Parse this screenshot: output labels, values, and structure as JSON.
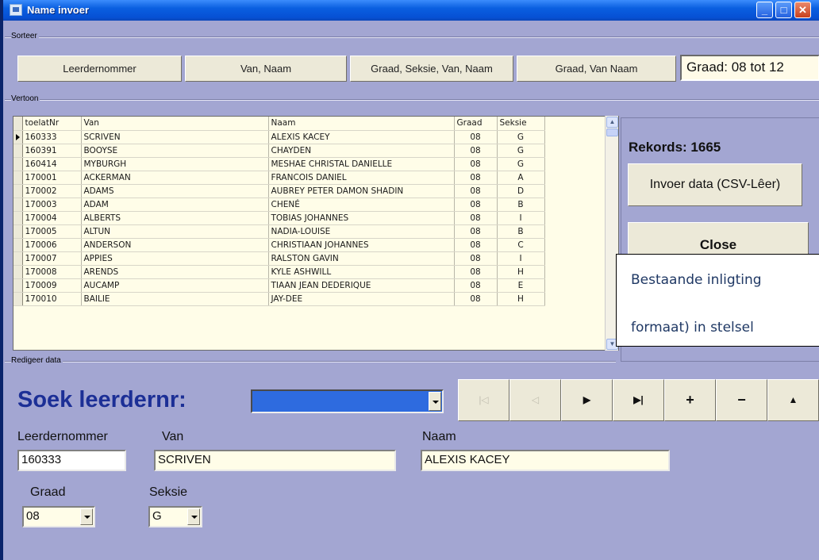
{
  "window": {
    "title": "Name invoer"
  },
  "sorteer": {
    "group_label": "Sorteer",
    "buttons": [
      "Leerdernommer",
      "Van, Naam",
      "Graad, Seksie, Van, Naam",
      "Graad, Van Naam"
    ],
    "graad_range": "Graad:  08 tot 12"
  },
  "vertoon": {
    "group_label": "Vertoon",
    "columns": [
      "toelatNr",
      "Van",
      "Naam",
      "Graad",
      "Seksie"
    ],
    "rows": [
      [
        "160333",
        "SCRIVEN",
        "ALEXIS KACEY",
        "08",
        "G"
      ],
      [
        "160391",
        "BOOYSE",
        "CHAYDEN",
        "08",
        "G"
      ],
      [
        "160414",
        "MYBURGH",
        "MESHAE CHRISTAL DANIELLE",
        "08",
        "G"
      ],
      [
        "170001",
        "ACKERMAN",
        "FRANCOIS DANIEL",
        "08",
        "A"
      ],
      [
        "170002",
        "ADAMS",
        "AUBREY PETER DAMON SHADIN",
        "08",
        "D"
      ],
      [
        "170003",
        "ADAM",
        "CHENÉ",
        "08",
        "B"
      ],
      [
        "170004",
        "ALBERTS",
        "TOBIAS JOHANNES",
        "08",
        "I"
      ],
      [
        "170005",
        "ALTUN",
        "NADIA-LOUISE",
        "08",
        "B"
      ],
      [
        "170006",
        "ANDERSON",
        "CHRISTIAAN JOHANNES",
        "08",
        "C"
      ],
      [
        "170007",
        "APPIES",
        "RALSTON GAVIN",
        "08",
        "I"
      ],
      [
        "170008",
        "ARENDS",
        "KYLE ASHWILL",
        "08",
        "H"
      ],
      [
        "170009",
        "AUCAMP",
        "TIAAN JEAN DEDERIQUE",
        "08",
        "E"
      ],
      [
        "170010",
        "BAILIE",
        "JAY-DEE",
        "08",
        "H"
      ]
    ],
    "rekords": "Rekords: 1665",
    "invoer_button": "Invoer data (CSV-Lêer)",
    "close_button": "Close"
  },
  "callout": {
    "line1": "Bestaande inligting",
    "line2": "formaat) in stelsel"
  },
  "redigeer": {
    "group_label": "Redigeer data",
    "soek_label": "Soek leerdernr:",
    "soek_value": "",
    "nav_buttons": [
      {
        "name": "nav-first-button",
        "glyph": "|◁",
        "enabled": false
      },
      {
        "name": "nav-prev-button",
        "glyph": "◁",
        "enabled": false
      },
      {
        "name": "nav-next-button",
        "glyph": "▶",
        "enabled": true
      },
      {
        "name": "nav-last-button",
        "glyph": "▶|",
        "enabled": true
      },
      {
        "name": "nav-insert-button",
        "glyph": "+",
        "enabled": true
      },
      {
        "name": "nav-delete-button",
        "glyph": "−",
        "enabled": true
      },
      {
        "name": "nav-edit-button",
        "glyph": "▲",
        "enabled": true
      }
    ],
    "leerdernommer_label": "Leerdernommer",
    "leerdernommer_value": "160333",
    "van_label": "Van",
    "van_value": "SCRIVEN",
    "naam_label": "Naam",
    "naam_value": "ALEXIS KACEY",
    "graad_label": "Graad",
    "graad_value": "08",
    "seksie_label": "Seksie",
    "seksie_value": "G"
  }
}
